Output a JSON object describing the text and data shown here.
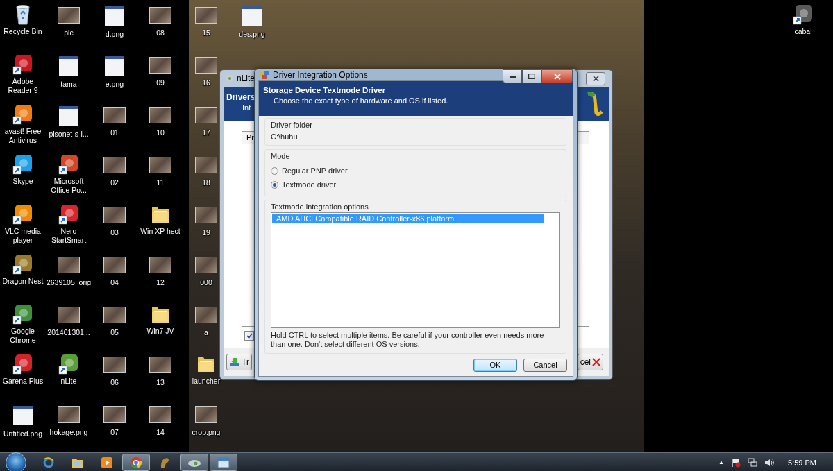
{
  "desktop": {
    "icon_columns": [
      [
        {
          "label": "Recycle Bin",
          "kind": "recycle"
        },
        {
          "label": "Adobe Reader 9",
          "kind": "app",
          "color": "#c8171e"
        },
        {
          "label": "avast! Free Antivirus",
          "kind": "app",
          "color": "#f07d14"
        },
        {
          "label": "Skype",
          "kind": "app",
          "color": "#1ea0e6"
        },
        {
          "label": "VLC media player",
          "kind": "app",
          "color": "#f08a00"
        },
        {
          "label": "Dragon Nest",
          "kind": "app",
          "color": "#9a7a2a"
        },
        {
          "label": "Google Chrome",
          "kind": "app",
          "color": "#3f8f3c"
        },
        {
          "label": "Garena Plus",
          "kind": "app",
          "color": "#d2232a"
        },
        {
          "label": "Untitled.png",
          "kind": "image"
        }
      ],
      [
        {
          "label": "pic",
          "kind": "photo"
        },
        {
          "label": "tama",
          "kind": "image"
        },
        {
          "label": "pisonet-s-l...",
          "kind": "image"
        },
        {
          "label": "Microsoft Office Po...",
          "kind": "app",
          "color": "#d24726"
        },
        {
          "label": "Nero StartSmart",
          "kind": "app",
          "color": "#d8262e"
        },
        {
          "label": "2639105_orig",
          "kind": "photo"
        },
        {
          "label": "201401301...",
          "kind": "photo"
        },
        {
          "label": "nLite",
          "kind": "app",
          "color": "#5a9e3a"
        },
        {
          "label": "hokage.png",
          "kind": "photo"
        }
      ],
      [
        {
          "label": "d.png",
          "kind": "image"
        },
        {
          "label": "e.png",
          "kind": "image"
        },
        {
          "label": "01",
          "kind": "photo"
        },
        {
          "label": "02",
          "kind": "photo"
        },
        {
          "label": "03",
          "kind": "photo"
        },
        {
          "label": "04",
          "kind": "photo"
        },
        {
          "label": "05",
          "kind": "photo"
        },
        {
          "label": "06",
          "kind": "photo"
        },
        {
          "label": "07",
          "kind": "photo"
        }
      ],
      [
        {
          "label": "08",
          "kind": "photo"
        },
        {
          "label": "09",
          "kind": "photo"
        },
        {
          "label": "10",
          "kind": "photo"
        },
        {
          "label": "11",
          "kind": "photo"
        },
        {
          "label": "Win XP hect",
          "kind": "folder"
        },
        {
          "label": "12",
          "kind": "photo"
        },
        {
          "label": "Win7 JV",
          "kind": "folder"
        },
        {
          "label": "13",
          "kind": "photo"
        },
        {
          "label": "14",
          "kind": "photo"
        }
      ],
      [
        {
          "label": "15",
          "kind": "photo"
        },
        {
          "label": "16",
          "kind": "photo"
        },
        {
          "label": "17",
          "kind": "photo"
        },
        {
          "label": "18",
          "kind": "photo"
        },
        {
          "label": "19",
          "kind": "photo"
        },
        {
          "label": "000",
          "kind": "photo"
        },
        {
          "label": "a",
          "kind": "photo"
        },
        {
          "label": "launcher",
          "kind": "folder"
        },
        {
          "label": "crop.png",
          "kind": "photo"
        }
      ],
      [
        {
          "label": "des.png",
          "kind": "image"
        }
      ]
    ],
    "right_icons": [
      {
        "label": "cabal",
        "kind": "app",
        "color": "#5a5a5a"
      }
    ]
  },
  "background_window": {
    "title": "nLite",
    "header_title": "Drivers",
    "header_subtitle": "Int",
    "column_header": "Pr",
    "checkbox_checked": true,
    "left_button": "Tr",
    "right_button": "cel"
  },
  "dialog": {
    "title": "Driver Integration Options",
    "header_title": "Storage Device Textmode Driver",
    "header_subtitle": "Choose the exact type of hardware and OS if listed.",
    "driver_folder": {
      "label": "Driver folder",
      "value": "C:\\huhu"
    },
    "mode": {
      "label": "Mode",
      "options": [
        {
          "label": "Regular PNP driver",
          "selected": false
        },
        {
          "label": "Textmode driver",
          "selected": true
        }
      ]
    },
    "integration": {
      "label": "Textmode integration options",
      "items": [
        {
          "label": "AMD AHCI Compatible RAID Controller-x86 platform",
          "selected": true
        }
      ],
      "hint": "Hold CTRL to select multiple items. Be careful if your controller even needs more than one. Don't select different OS versions."
    },
    "buttons": [
      {
        "label": "OK",
        "default": true
      },
      {
        "label": "Cancel",
        "default": false
      }
    ]
  },
  "taskbar": {
    "items": [
      {
        "kind": "browser",
        "active": false
      },
      {
        "kind": "folder",
        "active": false
      },
      {
        "kind": "media",
        "active": false
      },
      {
        "kind": "chrome",
        "active": true
      },
      {
        "kind": "game",
        "active": false
      },
      {
        "kind": "installer",
        "active": true
      },
      {
        "kind": "window",
        "active": true
      }
    ],
    "tray": {
      "expand": "▲",
      "clock": "5:59 PM"
    }
  }
}
